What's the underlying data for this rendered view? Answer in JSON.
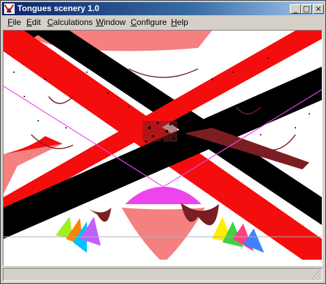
{
  "window": {
    "title": "Tongues scenery 1.0"
  },
  "caption_buttons": {
    "minimize": "_",
    "maximize": "□",
    "close": "×"
  },
  "menu": [
    {
      "label_u": "F",
      "label_rest": "ile"
    },
    {
      "label_u": "E",
      "label_rest": "dit"
    },
    {
      "label_u": "C",
      "label_rest": "alculations"
    },
    {
      "label_u": "W",
      "label_rest": "indow"
    },
    {
      "label_u": "C",
      "label_rest": "onfigure"
    },
    {
      "label_u": "H",
      "label_rest": "elp"
    }
  ],
  "colors": {
    "red": "#f40d0d",
    "salmon": "#f48080",
    "black": "#000000",
    "maroon": "#7a1e22",
    "magenta": "#ee44ee",
    "title_blue": "#0a246a"
  }
}
